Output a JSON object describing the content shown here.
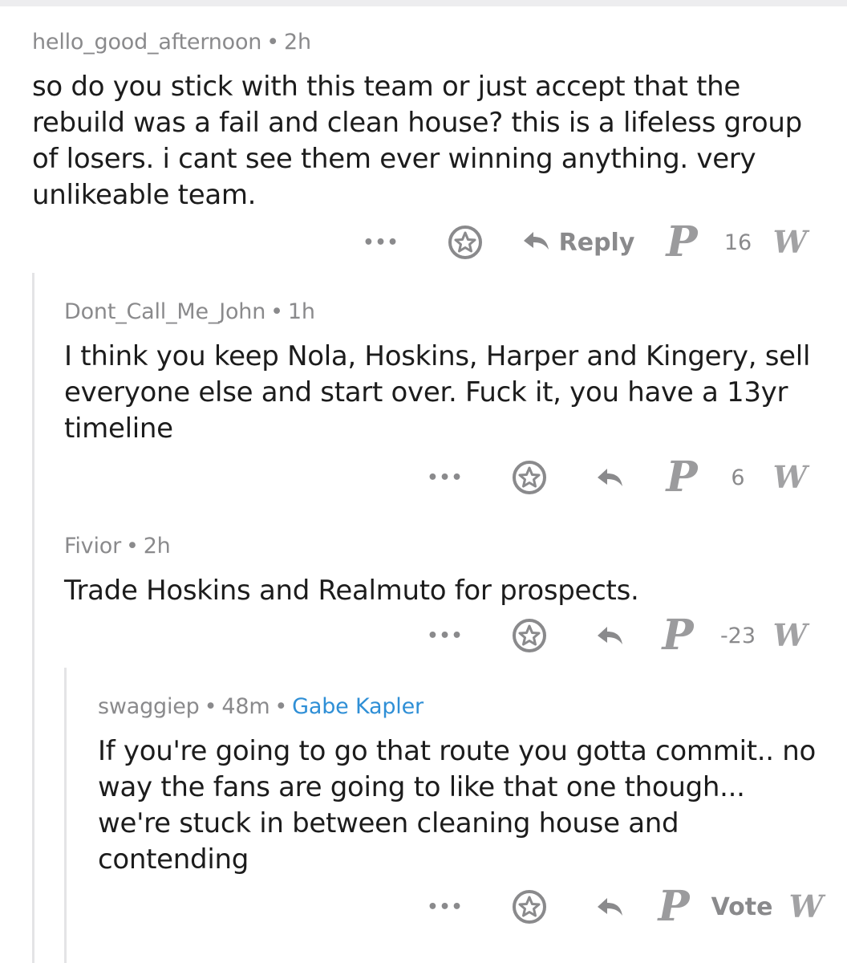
{
  "comments": [
    {
      "user": "hello_good_afternoon",
      "age": "2h",
      "flair": "",
      "body": "so do you stick with this team or just accept that the rebuild was a fail and clean house? this is a lifeless group of losers. i cant see them ever winning anything. very unlikeable team.",
      "reply_label": "Reply",
      "score": "16"
    },
    {
      "user": "Dont_Call_Me_John",
      "age": "1h",
      "flair": "",
      "body": "I think you keep Nola, Hoskins, Harper and Kingery, sell everyone else and start over. Fuck it, you have a 13yr timeline",
      "reply_label": "",
      "score": "6"
    },
    {
      "user": "Fivior",
      "age": "2h",
      "flair": "",
      "body": "Trade Hoskins and Realmuto for prospects.",
      "reply_label": "",
      "score": "-23"
    },
    {
      "user": "swaggiep",
      "age": "48m",
      "flair": "Gabe Kapler",
      "body": "If you're going to go that route you gotta commit.. no way the fans are going to like that one though... we're stuck in between cleaning house and contending",
      "reply_label": "",
      "score": "Vote"
    }
  ],
  "icons": {
    "more": "more-options-icon",
    "award": "award-icon",
    "reply": "reply-arrow-icon",
    "upvote": "phillies-p-upvote-icon",
    "downvote": "nationals-w-downvote-icon"
  },
  "glyphs": {
    "separator": "•",
    "more": "•••",
    "upvote": "P",
    "downvote": "W"
  },
  "colors": {
    "meta": "#8a8a8c",
    "flair": "#2f8fd6",
    "thread_line": "#e4e4e6",
    "icon": "#9b9b9d"
  }
}
